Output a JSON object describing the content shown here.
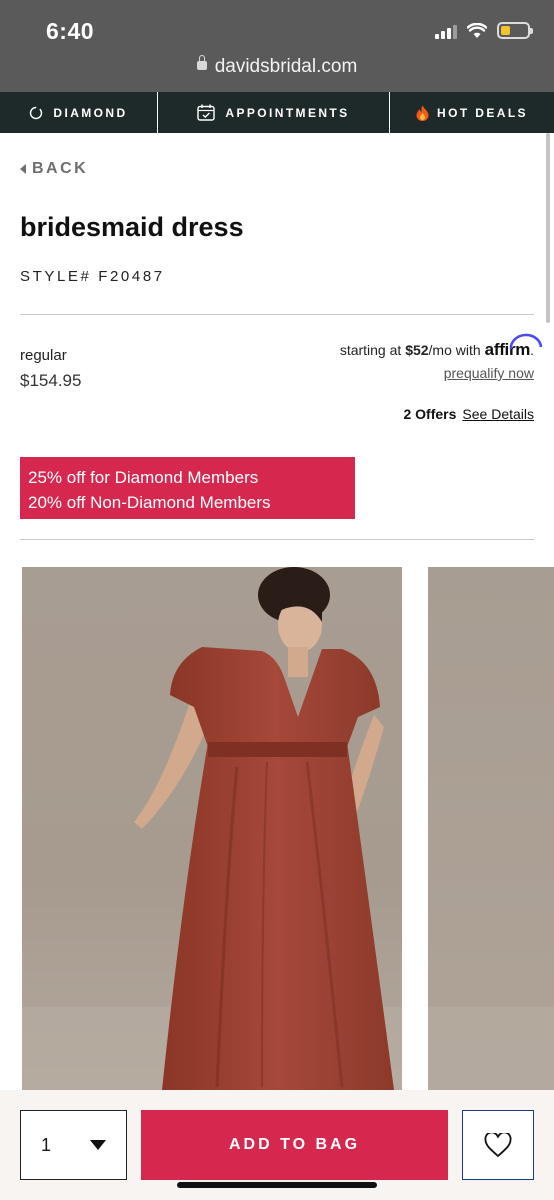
{
  "status": {
    "time": "6:40",
    "url": "davidsbridal.com"
  },
  "nav": {
    "diamond": "DIAMOND",
    "appointments": "APPOINTMENTS",
    "hot_deals": "HOT DEALS"
  },
  "back_label": "BACK",
  "product": {
    "title": "bridesmaid dress",
    "style": "STYLE# F20487",
    "price_label": "regular",
    "price": "$154.95"
  },
  "affirm": {
    "prefix": "starting at",
    "amount": "$52",
    "suffix": "/mo with",
    "brand": "affirm",
    "period": ".",
    "prequalify": "prequalify now"
  },
  "offers": {
    "count": "2 Offers",
    "link": "See Details"
  },
  "promo": {
    "line1": "25% off for Diamond Members",
    "line2": "20% off Non-Diamond Members"
  },
  "gallery": {
    "main_image": "model-in-rust-dress-image",
    "next_image": "next-product-image"
  },
  "bottom_bar": {
    "quantity": "1",
    "add_to_bag": "ADD TO BAG",
    "wishlist_icon": "heart-icon"
  },
  "colors": {
    "accent": "#d6284f",
    "nav_bg": "#1e2a2a",
    "dress": "#9e4433"
  }
}
